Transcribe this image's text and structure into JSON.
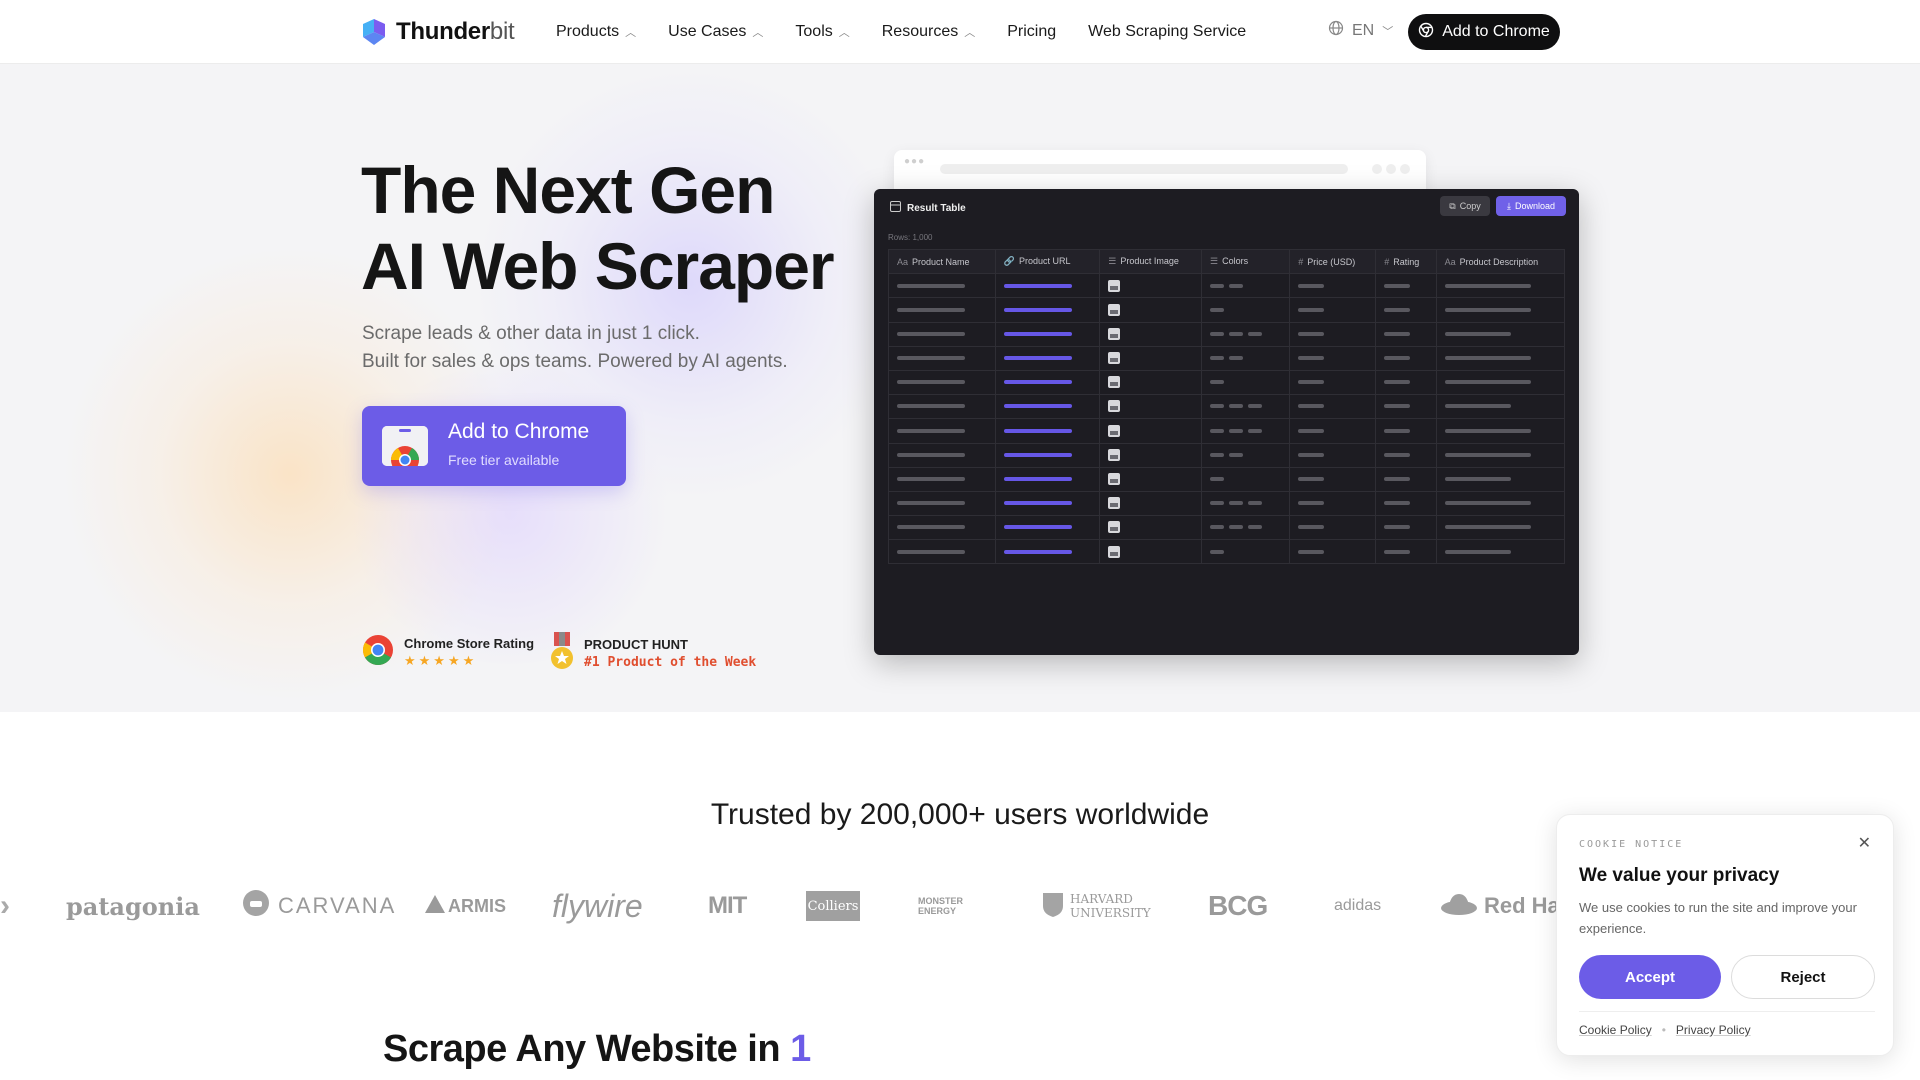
{
  "nav": {
    "logo_bold": "Thunder",
    "logo_light": "bit",
    "links": [
      {
        "label": "Products",
        "dropdown": true
      },
      {
        "label": "Use Cases",
        "dropdown": true
      },
      {
        "label": "Tools",
        "dropdown": true
      },
      {
        "label": "Resources",
        "dropdown": true
      },
      {
        "label": "Pricing",
        "dropdown": false
      },
      {
        "label": "Web Scraping Service",
        "dropdown": false
      }
    ],
    "language": "EN",
    "cta": "Add to Chrome"
  },
  "hero": {
    "title_line1": "The Next Gen",
    "title_line2": "AI Web Scraper",
    "subtitle_line1": "Scrape leads & other data in just 1 click.",
    "subtitle_line2": "Built for sales & ops teams. Powered by AI agents.",
    "cta_title": "Add to Chrome",
    "cta_sub": "Free tier available",
    "badges": {
      "chrome_title": "Chrome Store Rating",
      "chrome_stars": "★★★★★",
      "ph_title": "PRODUCT HUNT",
      "ph_sub": "#1 Product of the Week"
    }
  },
  "result_table": {
    "title": "Result Table",
    "rows_label": "Rows: 1,000",
    "copy_label": "Copy",
    "download_label": "Download",
    "columns": [
      {
        "icon": "Aa",
        "label": "Product Name"
      },
      {
        "icon": "🔗",
        "label": "Product URL"
      },
      {
        "icon": "☰",
        "label": "Product Image"
      },
      {
        "icon": "☰",
        "label": "Colors"
      },
      {
        "icon": "#",
        "label": "Price (USD)"
      },
      {
        "icon": "#",
        "label": "Rating"
      },
      {
        "icon": "Aa",
        "label": "Product Description"
      }
    ],
    "row_count": 12
  },
  "trusted": {
    "heading": "Trusted by 200,000+ users worldwide",
    "logos": [
      "patagonia",
      "CARVANA",
      "ARMIS",
      "flywire",
      "MIT",
      "Colliers",
      "MONSTER ENERGY",
      "HARVARD UNIVERSITY",
      "BCG",
      "adidas",
      "Red Hat"
    ]
  },
  "section2": {
    "heading": "Scrape Any Website in",
    "accent": "1"
  },
  "cookie": {
    "kicker": "COOKIE NOTICE",
    "title": "We value your privacy",
    "text": "We use cookies to run the site and improve your experience.",
    "accept": "Accept",
    "reject": "Reject",
    "link1": "Cookie Policy",
    "link2": "Privacy Policy"
  },
  "colors": {
    "brand": "#6c5ce7",
    "dark": "#0f0f10",
    "ph_red": "#e04e2f",
    "star": "#f6a623"
  }
}
